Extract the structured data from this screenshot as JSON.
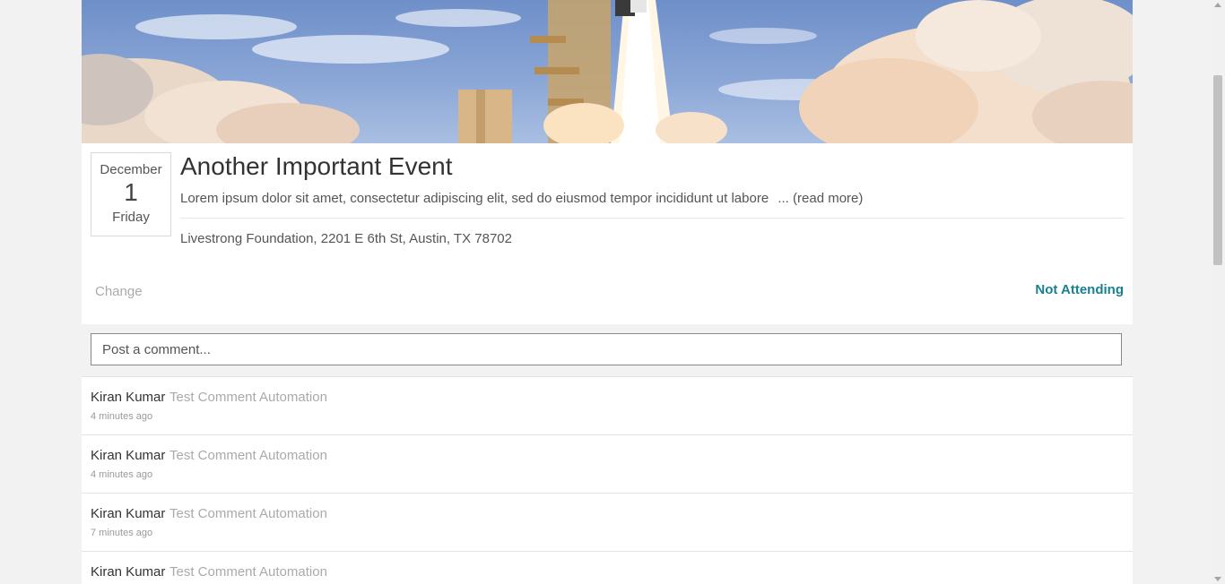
{
  "event": {
    "image_alt": "space shuttle launch",
    "date": {
      "month": "December",
      "day": "1",
      "weekday": "Friday"
    },
    "title": "Another Important Event",
    "description": "Lorem ipsum dolor sit amet, consectetur adipiscing elit, sed do eiusmod tempor incididunt ut labore",
    "read_more": "... (read more)",
    "location": "Livestrong Foundation, 2201 E 6th St, Austin, TX 78702",
    "change_label": "Change",
    "rsvp_status": "Not Attending",
    "rsvp_color": "#1a7f8e"
  },
  "comment_box": {
    "placeholder": "Post a comment..."
  },
  "comments": [
    {
      "author": "Kiran Kumar",
      "text": "Test Comment Automation",
      "time": "4 minutes ago"
    },
    {
      "author": "Kiran Kumar",
      "text": "Test Comment Automation",
      "time": "4 minutes ago"
    },
    {
      "author": "Kiran Kumar",
      "text": "Test Comment Automation",
      "time": "7 minutes ago"
    },
    {
      "author": "Kiran Kumar",
      "text": "Test Comment Automation",
      "time": ""
    }
  ]
}
